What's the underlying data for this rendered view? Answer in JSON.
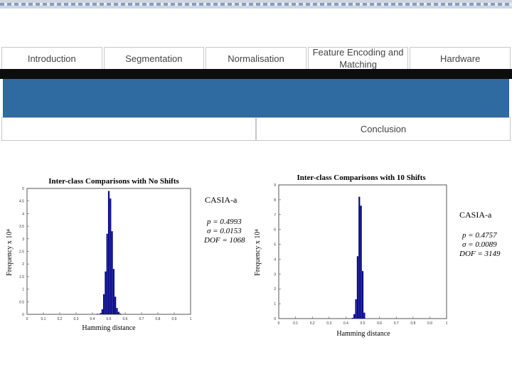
{
  "nav": {
    "items": [
      "Introduction",
      "Segmentation",
      "Normalisation",
      "Feature Encoding and Matching",
      "Hardware"
    ],
    "sub_items": [
      "",
      "Conclusion"
    ]
  },
  "colors": {
    "band": "#2f6aa0",
    "bar": "#0a0a8c"
  },
  "charts": [
    {
      "title": "Inter-class Comparisons with No Shifts",
      "xlabel": "Hamming distance",
      "ylabel": "Frequency x 10⁴",
      "xticks": [
        "0",
        "0.1",
        "0.2",
        "0.3",
        "0.4",
        "0.5",
        "0.6",
        "0.7",
        "0.8",
        "0.9",
        "1"
      ],
      "yticks": [
        "0",
        "0.5",
        "1",
        "1.5",
        "2",
        "2.5",
        "3",
        "3.5",
        "4",
        "4.5",
        "5"
      ],
      "dataset": "CASIA-a",
      "stats": [
        "p = 0.4993",
        "σ = 0.0153",
        "DOF = 1068"
      ]
    },
    {
      "title": "Inter-class Comparisons with 10 Shifts",
      "xlabel": "Hamming distance",
      "ylabel": "Frequency x 10⁴",
      "xticks": [
        "0",
        "0.1",
        "0.2",
        "0.3",
        "0.4",
        "0.5",
        "0.6",
        "0.7",
        "0.8",
        "0.9",
        "1"
      ],
      "yticks": [
        "0",
        "1",
        "2",
        "3",
        "4",
        "5",
        "6",
        "7",
        "8",
        "9"
      ],
      "dataset": "CASIA-a",
      "stats": [
        "p = 0.4757",
        "σ = 0.0089",
        "DOF = 3149"
      ]
    }
  ],
  "chart_data": [
    {
      "type": "bar",
      "x": [
        0.43,
        0.45,
        0.46,
        0.47,
        0.48,
        0.49,
        0.5,
        0.51,
        0.52,
        0.53,
        0.54,
        0.55,
        0.56,
        0.57
      ],
      "values": [
        0.02,
        0.05,
        0.2,
        0.8,
        1.7,
        3.2,
        4.9,
        4.6,
        3.3,
        1.8,
        0.7,
        0.25,
        0.1,
        0.03
      ],
      "ylim": [
        0,
        5
      ],
      "xlim": [
        0,
        1
      ]
    },
    {
      "type": "bar",
      "x": [
        0.44,
        0.45,
        0.46,
        0.47,
        0.48,
        0.49,
        0.5,
        0.51
      ],
      "values": [
        0.05,
        0.3,
        1.3,
        4.2,
        8.2,
        7.6,
        3.2,
        0.4
      ],
      "ylim": [
        0,
        9
      ],
      "xlim": [
        0,
        1
      ]
    }
  ]
}
